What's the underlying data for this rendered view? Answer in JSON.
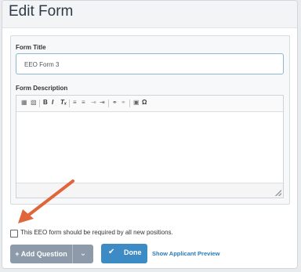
{
  "header": {
    "title": "Edit Form"
  },
  "form_title": {
    "label": "Form Title",
    "value": "EEO Form 3"
  },
  "form_description": {
    "label": "Form Description",
    "toolbar": [
      "B",
      "I",
      "Ω"
    ]
  },
  "required_checkbox": {
    "label": "This EEO form should be required by all new positions.",
    "checked": false
  },
  "actions": {
    "add_question": "+ Add Question",
    "add_question_caret": "⌄",
    "done_check": "✔",
    "done": "Done",
    "preview": "Show Applicant Preview"
  },
  "colors": {
    "done_button": "#3c8bc5",
    "add_button": "#8d9aa9",
    "link": "#2a7ab8",
    "arrow": "#e0653a"
  }
}
